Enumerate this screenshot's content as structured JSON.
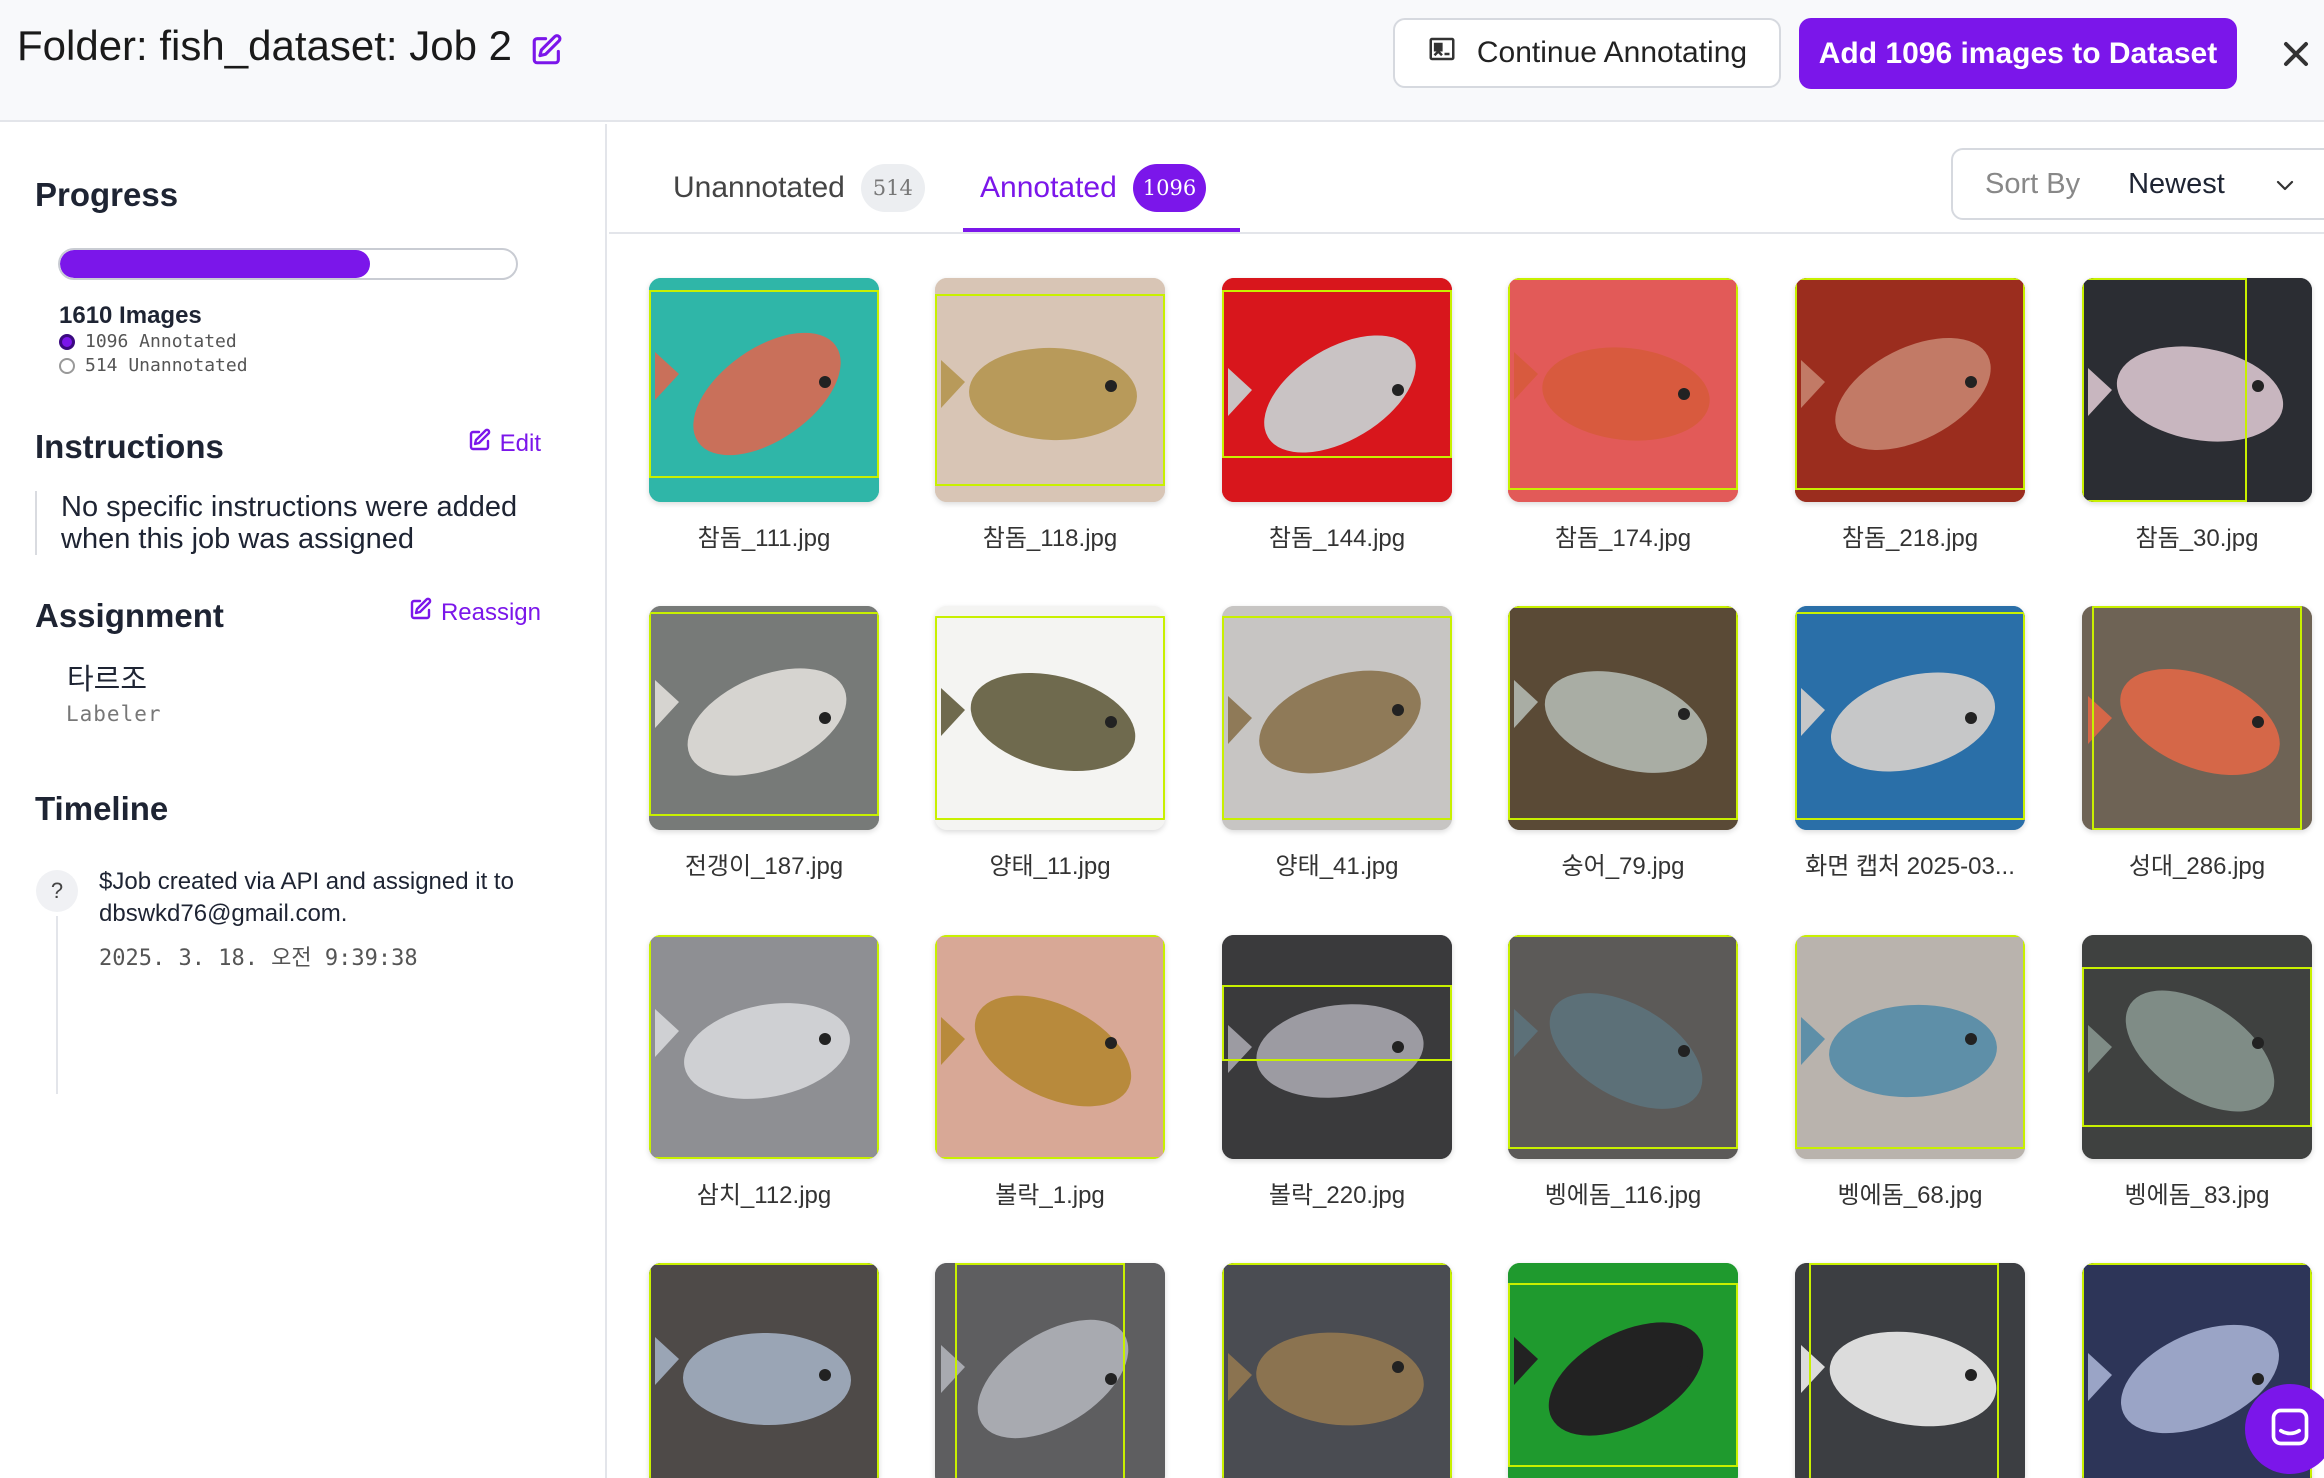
{
  "header": {
    "folder_title": "Folder: fish_dataset: Job 2",
    "continue_label": "Continue Annotating",
    "add_label": "Add 1096 images to Dataset"
  },
  "sidebar": {
    "progress_heading": "Progress",
    "progress_fraction": 0.68,
    "image_count": "1610 Images",
    "annotated_text": "1096 Annotated",
    "unannotated_text": "514 Unannotated",
    "instructions_heading": "Instructions",
    "edit_label": "Edit",
    "instructions_text": "No specific instructions were added when this job was assigned",
    "assignment_heading": "Assignment",
    "reassign_label": "Reassign",
    "assignee_name": "타르조",
    "assignee_role": "Labeler",
    "timeline_heading": "Timeline",
    "timeline_icon": "?",
    "timeline_text": "$Job created via API and assigned it to dbswkd76@gmail.com.",
    "timeline_date": "2025. 3. 18. 오전 9:39:38"
  },
  "tabs": {
    "unannotated_label": "Unannotated",
    "unannotated_count": "514",
    "annotated_label": "Annotated",
    "annotated_count": "1096"
  },
  "sort": {
    "label": "Sort By",
    "value": "Newest"
  },
  "colors": {
    "accent": "#7b16ea",
    "bbox": "#c8f000"
  },
  "images": [
    {
      "name": "참돔_111.jpg",
      "bg": "#2fb6a8",
      "fish": "#c9705a"
    },
    {
      "name": "참돔_118.jpg",
      "bg": "#d8c5b5",
      "fish": "#b89a5a"
    },
    {
      "name": "참돔_144.jpg",
      "bg": "#d8161c",
      "fish": "#c9c3c4"
    },
    {
      "name": "참돔_174.jpg",
      "bg": "#e25a58",
      "fish": "#d85a3e"
    },
    {
      "name": "참돔_218.jpg",
      "bg": "#9b2d1e",
      "fish": "#c27a66"
    },
    {
      "name": "참돔_30.jpg",
      "bg": "#2b2d33",
      "fish": "#c8b6bf"
    },
    {
      "name": "전갱이_187.jpg",
      "bg": "#777a78",
      "fish": "#d6d4d0"
    },
    {
      "name": "양태_11.jpg",
      "bg": "#f4f4f2",
      "fish": "#6f6a4e"
    },
    {
      "name": "양태_41.jpg",
      "bg": "#c7c5c3",
      "fish": "#8f7a58"
    },
    {
      "name": "숭어_79.jpg",
      "bg": "#5a4a36",
      "fish": "#a9ada4"
    },
    {
      "name": "화면 캡처 2025-03...",
      "bg": "#2a6fa8",
      "fish": "#c6c7c8"
    },
    {
      "name": "성대_286.jpg",
      "bg": "#6e6355",
      "fish": "#d56748"
    },
    {
      "name": "삼치_112.jpg",
      "bg": "#8e8f93",
      "fish": "#cfd0d3"
    },
    {
      "name": "볼락_1.jpg",
      "bg": "#d8a896",
      "fish": "#b88a3c"
    },
    {
      "name": "볼락_220.jpg",
      "bg": "#3a3a3c",
      "fish": "#9c9ba2"
    },
    {
      "name": "벵에돔_116.jpg",
      "bg": "#5c5a58",
      "fish": "#5c7078"
    },
    {
      "name": "벵에돔_68.jpg",
      "bg": "#b9b3ad",
      "fish": "#5e8fa8"
    },
    {
      "name": "벵에돔_83.jpg",
      "bg": "#3f4140",
      "fish": "#7f8c86"
    },
    {
      "name": "",
      "bg": "#4e4a48",
      "fish": "#9aa5b5"
    },
    {
      "name": "",
      "bg": "#5e5e60",
      "fish": "#a8aab0"
    },
    {
      "name": "",
      "bg": "#4a4c52",
      "fish": "#8b7350"
    },
    {
      "name": "",
      "bg": "#1f9a2e",
      "fish": "#222222"
    },
    {
      "name": "",
      "bg": "#3c3e42",
      "fish": "#dcdcdc"
    },
    {
      "name": "",
      "bg": "#2d3558",
      "fish": "#9aa4c6"
    }
  ]
}
